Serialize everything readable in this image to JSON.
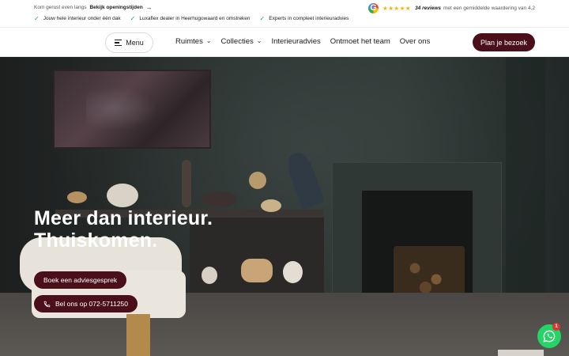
{
  "topbar": {
    "visit_text": "Kom gerust even langs",
    "hours_link": "Bekijk openingstijden",
    "usps": [
      "Jouw hele interieur onder één dak",
      "Luxaflex dealer in Heerhugowaard en omstreken",
      "Experts in compleet interieuradvies"
    ],
    "reviews": {
      "stars": "★★★★★",
      "count_text": "34 reviews",
      "rating_text": "met een gemiddelde waardering van 4,2",
      "rating": 4.2
    }
  },
  "nav": {
    "menu_label": "Menu",
    "links": [
      "Ruimtes",
      "Collecties",
      "Interieuradvies",
      "Ontmoet het team",
      "Over ons"
    ],
    "cta_label": "Plan je bezoek"
  },
  "hero": {
    "title_line1": "Meer dan interieur.",
    "title_line2": "Thuiskomen.",
    "primary_button": "Boek een adviesgesprek",
    "phone_button": "Bel ons op 072-5711250"
  },
  "whatsapp": {
    "badge_count": "1"
  },
  "colors": {
    "accent": "#4a0f18",
    "check": "#3a9a5b",
    "star": "#f4b400",
    "whatsapp": "#25d366"
  }
}
